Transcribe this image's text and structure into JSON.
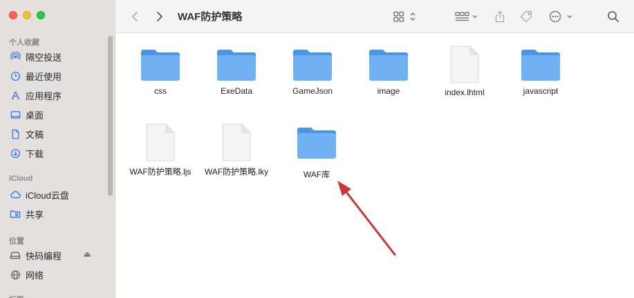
{
  "window": {
    "title": "WAF防护策略"
  },
  "sidebar": {
    "favorites_title": "个人收藏",
    "favorites": [
      {
        "label": "隔空投送",
        "icon": "airdrop-icon"
      },
      {
        "label": "最近使用",
        "icon": "clock-icon"
      },
      {
        "label": "应用程序",
        "icon": "applications-icon"
      },
      {
        "label": "桌面",
        "icon": "desktop-icon"
      },
      {
        "label": "文稿",
        "icon": "document-icon"
      },
      {
        "label": "下载",
        "icon": "download-icon"
      }
    ],
    "icloud_title": "iCloud",
    "icloud": [
      {
        "label": "iCloud云盘",
        "icon": "cloud-icon"
      },
      {
        "label": "共享",
        "icon": "shared-folder-icon"
      }
    ],
    "locations_title": "位置",
    "locations": [
      {
        "label": "快码编程",
        "icon": "drive-icon"
      },
      {
        "label": "网络",
        "icon": "network-icon"
      }
    ],
    "tags_title_partial": "标签"
  },
  "files": [
    {
      "name": "css",
      "kind": "folder"
    },
    {
      "name": "ExeData",
      "kind": "folder"
    },
    {
      "name": "GameJson",
      "kind": "folder"
    },
    {
      "name": "image",
      "kind": "folder"
    },
    {
      "name": "index.lhtml",
      "kind": "document"
    },
    {
      "name": "javascript",
      "kind": "folder"
    },
    {
      "name": "WAF防护策略.ljs",
      "kind": "document"
    },
    {
      "name": "WAF防护策略.lky",
      "kind": "document"
    },
    {
      "name": "WAF库",
      "kind": "folder"
    }
  ],
  "colors": {
    "accent": "#2f7bf0",
    "folder": "#6fb1f2",
    "arrow": "#d0342c"
  }
}
